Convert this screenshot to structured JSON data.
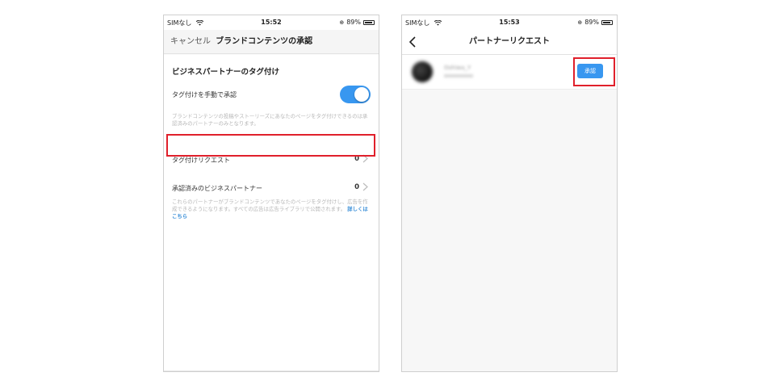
{
  "left_screen": {
    "status": {
      "carrier": "SIMなし",
      "time": "15:52",
      "battery": "89%"
    },
    "nav": {
      "cancel": "キャンセル",
      "title": "ブランドコンテンツの承認"
    },
    "section_title": "ビジネスパートナーのタグ付け",
    "toggle": {
      "label": "タグ付けを手動で承認",
      "on": true
    },
    "description_1": "ブランドコンテンツの投稿やストーリーズにあなたのページをタグ付けできるのは承認済みのパートナーのみとなります。",
    "rows": [
      {
        "label": "タグ付けリクエスト",
        "count": "0"
      },
      {
        "label": "承認済みのビジネスパートナー",
        "count": "0"
      }
    ],
    "description_2": "これらのパートナーがブランドコンテンツであなたのページをタグ付けし、広告を作成できるようになります。すべての広告は広告ライブラリで公開されます。",
    "description_2_link": "詳しくはこちら"
  },
  "right_screen": {
    "status": {
      "carrier": "SIMなし",
      "time": "15:53",
      "battery": "89%"
    },
    "nav": {
      "title": "パートナーリクエスト"
    },
    "request": {
      "name": "Oshiwa_Y",
      "approve_label": "承認"
    }
  },
  "colors": {
    "accent": "#3897f0",
    "highlight": "#e0202b"
  }
}
